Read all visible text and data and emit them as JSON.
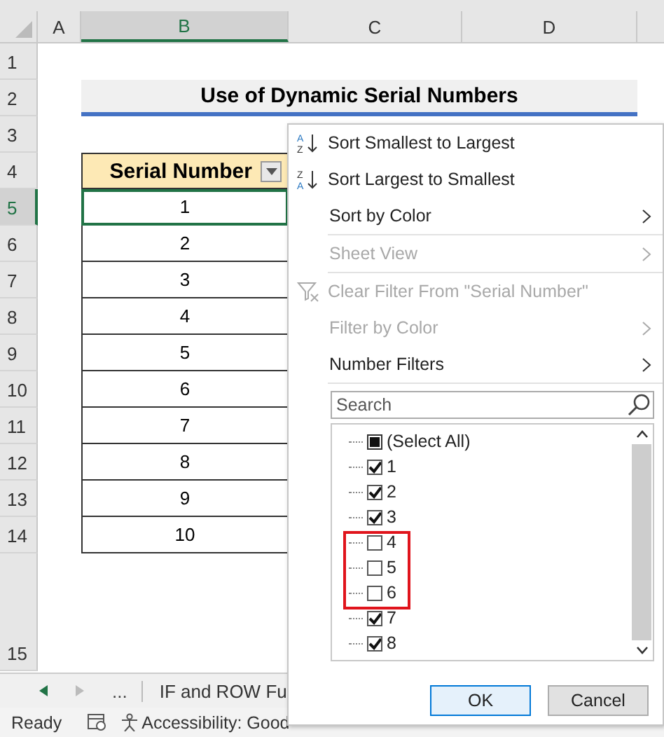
{
  "columns": [
    {
      "label": "A",
      "selected": false
    },
    {
      "label": "B",
      "selected": true
    },
    {
      "label": "C",
      "selected": false
    },
    {
      "label": "D",
      "selected": false
    }
  ],
  "rows": [
    {
      "label": "1",
      "selected": false
    },
    {
      "label": "2",
      "selected": false
    },
    {
      "label": "3",
      "selected": false
    },
    {
      "label": "4",
      "selected": false
    },
    {
      "label": "5",
      "selected": true
    },
    {
      "label": "6",
      "selected": false
    },
    {
      "label": "7",
      "selected": false
    },
    {
      "label": "8",
      "selected": false
    },
    {
      "label": "9",
      "selected": false
    },
    {
      "label": "10",
      "selected": false
    },
    {
      "label": "11",
      "selected": false
    },
    {
      "label": "12",
      "selected": false
    },
    {
      "label": "13",
      "selected": false
    },
    {
      "label": "14",
      "selected": false
    },
    {
      "label": "15",
      "selected": false
    }
  ],
  "title": "Use of Dynamic Serial Numbers",
  "table": {
    "header": "Serial Number",
    "values": [
      "1",
      "2",
      "3",
      "4",
      "5",
      "6",
      "7",
      "8",
      "9",
      "10"
    ]
  },
  "filter_menu": {
    "items": [
      {
        "kind": "sort-asc",
        "icon_letters": [
          "A",
          "Z"
        ],
        "label": "Sort Smallest to Largest",
        "disabled": false,
        "submenu": false
      },
      {
        "kind": "sort-desc",
        "icon_letters": [
          "Z",
          "A"
        ],
        "label": "Sort Largest to Smallest",
        "disabled": false,
        "submenu": false
      },
      {
        "kind": "plain",
        "label": "Sort by Color",
        "disabled": false,
        "submenu": true
      },
      {
        "kind": "plain",
        "label": "Sheet View",
        "disabled": true,
        "submenu": true
      },
      {
        "kind": "clear-filter",
        "label": "Clear Filter From \"Serial Number\"",
        "disabled": true,
        "submenu": false
      },
      {
        "kind": "plain",
        "label": "Filter by Color",
        "disabled": true,
        "submenu": true
      },
      {
        "kind": "plain",
        "label": "Number Filters",
        "disabled": false,
        "submenu": true
      }
    ],
    "search": {
      "placeholder": "Search"
    },
    "list": [
      {
        "kind": "partial",
        "label": "(Select All)",
        "checked": true,
        "highlighted": false
      },
      {
        "kind": "box",
        "label": "1",
        "checked": true,
        "highlighted": false
      },
      {
        "kind": "box",
        "label": "2",
        "checked": true,
        "highlighted": false
      },
      {
        "kind": "box",
        "label": "3",
        "checked": true,
        "highlighted": false
      },
      {
        "kind": "box",
        "label": "4",
        "checked": false,
        "highlighted": true
      },
      {
        "kind": "box",
        "label": "5",
        "checked": false,
        "highlighted": true
      },
      {
        "kind": "box",
        "label": "6",
        "checked": false,
        "highlighted": true
      },
      {
        "kind": "box",
        "label": "7",
        "checked": true,
        "highlighted": false
      },
      {
        "kind": "box",
        "label": "8",
        "checked": true,
        "highlighted": false
      }
    ],
    "buttons": [
      "OK",
      "Cancel"
    ]
  },
  "sheet_tabs": {
    "more": "...",
    "tab": "IF and ROW Fu"
  },
  "status_bar": {
    "mode": "Ready",
    "accessibility": "Accessibility: Good"
  }
}
